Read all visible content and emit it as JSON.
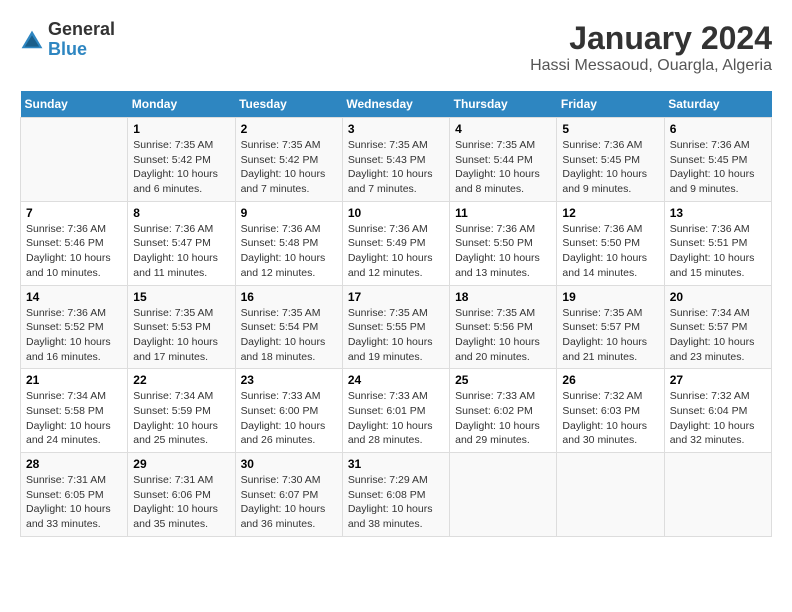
{
  "header": {
    "logo_general": "General",
    "logo_blue": "Blue",
    "main_title": "January 2024",
    "sub_title": "Hassi Messaoud, Ouargla, Algeria"
  },
  "days_of_week": [
    "Sunday",
    "Monday",
    "Tuesday",
    "Wednesday",
    "Thursday",
    "Friday",
    "Saturday"
  ],
  "weeks": [
    [
      {
        "day": "",
        "sunrise": "",
        "sunset": "",
        "daylight": ""
      },
      {
        "day": "1",
        "sunrise": "Sunrise: 7:35 AM",
        "sunset": "Sunset: 5:42 PM",
        "daylight": "Daylight: 10 hours and 6 minutes."
      },
      {
        "day": "2",
        "sunrise": "Sunrise: 7:35 AM",
        "sunset": "Sunset: 5:42 PM",
        "daylight": "Daylight: 10 hours and 7 minutes."
      },
      {
        "day": "3",
        "sunrise": "Sunrise: 7:35 AM",
        "sunset": "Sunset: 5:43 PM",
        "daylight": "Daylight: 10 hours and 7 minutes."
      },
      {
        "day": "4",
        "sunrise": "Sunrise: 7:35 AM",
        "sunset": "Sunset: 5:44 PM",
        "daylight": "Daylight: 10 hours and 8 minutes."
      },
      {
        "day": "5",
        "sunrise": "Sunrise: 7:36 AM",
        "sunset": "Sunset: 5:45 PM",
        "daylight": "Daylight: 10 hours and 9 minutes."
      },
      {
        "day": "6",
        "sunrise": "Sunrise: 7:36 AM",
        "sunset": "Sunset: 5:45 PM",
        "daylight": "Daylight: 10 hours and 9 minutes."
      }
    ],
    [
      {
        "day": "7",
        "sunrise": "Sunrise: 7:36 AM",
        "sunset": "Sunset: 5:46 PM",
        "daylight": "Daylight: 10 hours and 10 minutes."
      },
      {
        "day": "8",
        "sunrise": "Sunrise: 7:36 AM",
        "sunset": "Sunset: 5:47 PM",
        "daylight": "Daylight: 10 hours and 11 minutes."
      },
      {
        "day": "9",
        "sunrise": "Sunrise: 7:36 AM",
        "sunset": "Sunset: 5:48 PM",
        "daylight": "Daylight: 10 hours and 12 minutes."
      },
      {
        "day": "10",
        "sunrise": "Sunrise: 7:36 AM",
        "sunset": "Sunset: 5:49 PM",
        "daylight": "Daylight: 10 hours and 12 minutes."
      },
      {
        "day": "11",
        "sunrise": "Sunrise: 7:36 AM",
        "sunset": "Sunset: 5:50 PM",
        "daylight": "Daylight: 10 hours and 13 minutes."
      },
      {
        "day": "12",
        "sunrise": "Sunrise: 7:36 AM",
        "sunset": "Sunset: 5:50 PM",
        "daylight": "Daylight: 10 hours and 14 minutes."
      },
      {
        "day": "13",
        "sunrise": "Sunrise: 7:36 AM",
        "sunset": "Sunset: 5:51 PM",
        "daylight": "Daylight: 10 hours and 15 minutes."
      }
    ],
    [
      {
        "day": "14",
        "sunrise": "Sunrise: 7:36 AM",
        "sunset": "Sunset: 5:52 PM",
        "daylight": "Daylight: 10 hours and 16 minutes."
      },
      {
        "day": "15",
        "sunrise": "Sunrise: 7:35 AM",
        "sunset": "Sunset: 5:53 PM",
        "daylight": "Daylight: 10 hours and 17 minutes."
      },
      {
        "day": "16",
        "sunrise": "Sunrise: 7:35 AM",
        "sunset": "Sunset: 5:54 PM",
        "daylight": "Daylight: 10 hours and 18 minutes."
      },
      {
        "day": "17",
        "sunrise": "Sunrise: 7:35 AM",
        "sunset": "Sunset: 5:55 PM",
        "daylight": "Daylight: 10 hours and 19 minutes."
      },
      {
        "day": "18",
        "sunrise": "Sunrise: 7:35 AM",
        "sunset": "Sunset: 5:56 PM",
        "daylight": "Daylight: 10 hours and 20 minutes."
      },
      {
        "day": "19",
        "sunrise": "Sunrise: 7:35 AM",
        "sunset": "Sunset: 5:57 PM",
        "daylight": "Daylight: 10 hours and 21 minutes."
      },
      {
        "day": "20",
        "sunrise": "Sunrise: 7:34 AM",
        "sunset": "Sunset: 5:57 PM",
        "daylight": "Daylight: 10 hours and 23 minutes."
      }
    ],
    [
      {
        "day": "21",
        "sunrise": "Sunrise: 7:34 AM",
        "sunset": "Sunset: 5:58 PM",
        "daylight": "Daylight: 10 hours and 24 minutes."
      },
      {
        "day": "22",
        "sunrise": "Sunrise: 7:34 AM",
        "sunset": "Sunset: 5:59 PM",
        "daylight": "Daylight: 10 hours and 25 minutes."
      },
      {
        "day": "23",
        "sunrise": "Sunrise: 7:33 AM",
        "sunset": "Sunset: 6:00 PM",
        "daylight": "Daylight: 10 hours and 26 minutes."
      },
      {
        "day": "24",
        "sunrise": "Sunrise: 7:33 AM",
        "sunset": "Sunset: 6:01 PM",
        "daylight": "Daylight: 10 hours and 28 minutes."
      },
      {
        "day": "25",
        "sunrise": "Sunrise: 7:33 AM",
        "sunset": "Sunset: 6:02 PM",
        "daylight": "Daylight: 10 hours and 29 minutes."
      },
      {
        "day": "26",
        "sunrise": "Sunrise: 7:32 AM",
        "sunset": "Sunset: 6:03 PM",
        "daylight": "Daylight: 10 hours and 30 minutes."
      },
      {
        "day": "27",
        "sunrise": "Sunrise: 7:32 AM",
        "sunset": "Sunset: 6:04 PM",
        "daylight": "Daylight: 10 hours and 32 minutes."
      }
    ],
    [
      {
        "day": "28",
        "sunrise": "Sunrise: 7:31 AM",
        "sunset": "Sunset: 6:05 PM",
        "daylight": "Daylight: 10 hours and 33 minutes."
      },
      {
        "day": "29",
        "sunrise": "Sunrise: 7:31 AM",
        "sunset": "Sunset: 6:06 PM",
        "daylight": "Daylight: 10 hours and 35 minutes."
      },
      {
        "day": "30",
        "sunrise": "Sunrise: 7:30 AM",
        "sunset": "Sunset: 6:07 PM",
        "daylight": "Daylight: 10 hours and 36 minutes."
      },
      {
        "day": "31",
        "sunrise": "Sunrise: 7:29 AM",
        "sunset": "Sunset: 6:08 PM",
        "daylight": "Daylight: 10 hours and 38 minutes."
      },
      {
        "day": "",
        "sunrise": "",
        "sunset": "",
        "daylight": ""
      },
      {
        "day": "",
        "sunrise": "",
        "sunset": "",
        "daylight": ""
      },
      {
        "day": "",
        "sunrise": "",
        "sunset": "",
        "daylight": ""
      }
    ]
  ]
}
